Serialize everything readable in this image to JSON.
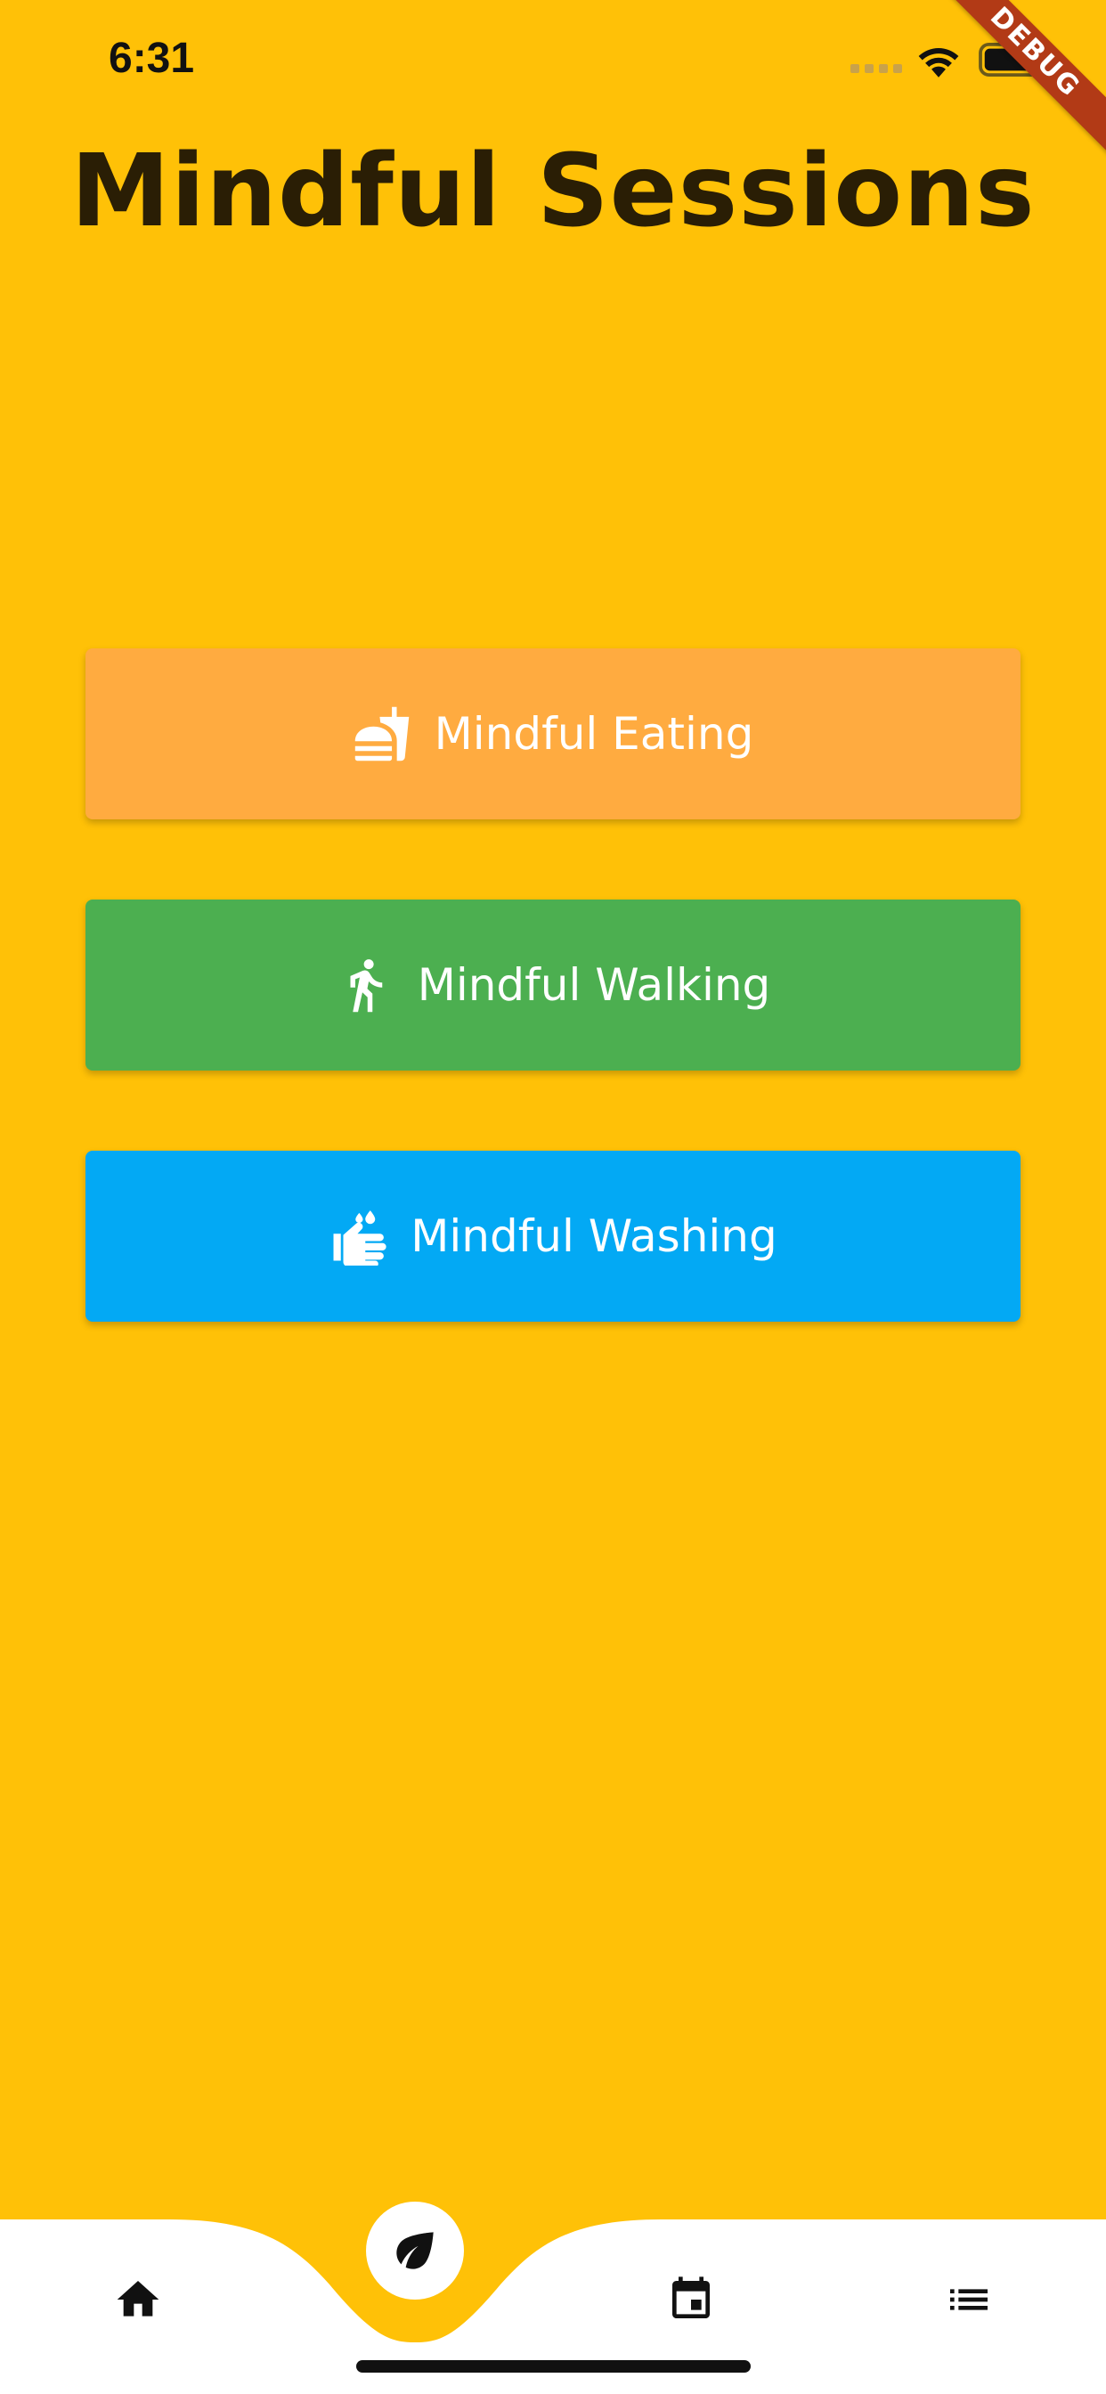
{
  "status_bar": {
    "time": "6:31",
    "icons": [
      "signal-dots-icon",
      "wifi-icon",
      "battery-icon"
    ]
  },
  "debug_banner": {
    "label": "DEBUG",
    "color": "#B23A16"
  },
  "header": {
    "title": "Mindful Sessions"
  },
  "sessions": [
    {
      "label": "Mindful Eating",
      "icon": "fastfood-icon",
      "color": "#FFAB40"
    },
    {
      "label": "Mindful Walking",
      "icon": "walking-icon",
      "color": "#4CAF50"
    },
    {
      "label": "Mindful Washing",
      "icon": "hand-wash-icon",
      "color": "#03A9F4"
    }
  ],
  "bottom_nav": {
    "items": [
      {
        "icon": "home-icon",
        "selected": false
      },
      {
        "icon": "leaf-icon",
        "selected": true
      },
      {
        "icon": "calendar-icon",
        "selected": false
      },
      {
        "icon": "list-icon",
        "selected": false
      }
    ]
  },
  "colors": {
    "background": "#FFC107",
    "title": "#2A1E05",
    "nav_background": "#FFFFFF"
  }
}
